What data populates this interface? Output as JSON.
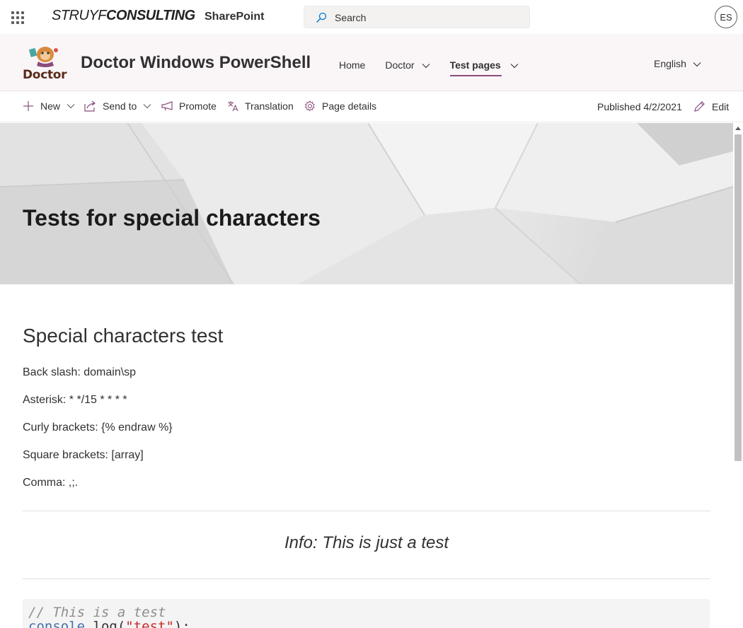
{
  "suitebar": {
    "logo_light": "STRUYF",
    "logo_bold": "CONSULTING",
    "app_name": "SharePoint",
    "search_placeholder": "Search",
    "avatar_initials": "ES"
  },
  "site": {
    "logo_label": "Doctor",
    "title": "Doctor Windows PowerShell",
    "nav": [
      {
        "label": "Home"
      },
      {
        "label": "Doctor"
      },
      {
        "label": "Test pages"
      }
    ],
    "language": "English"
  },
  "commandbar": {
    "new_label": "New",
    "send_to_label": "Send to",
    "promote_label": "Promote",
    "translation_label": "Translation",
    "page_details_label": "Page details",
    "published": "Published 4/2/2021",
    "edit_label": "Edit"
  },
  "hero": {
    "title": "Tests for special characters"
  },
  "content": {
    "heading": "Special characters test",
    "paragraphs": [
      "Back slash: domain\\sp",
      "Asterisk: * */15 * * * *",
      "Curly brackets: {% endraw %}",
      "Square brackets: [array]",
      "Comma: ,;."
    ],
    "callout": "Info: This is just a test",
    "code": {
      "comment": "// This is a test",
      "object": "console",
      "method": ".log(",
      "string": "\"test\"",
      "end": ");"
    }
  },
  "colors": {
    "accent": "#8a4e7a",
    "header_bg": "#faf6f8"
  }
}
